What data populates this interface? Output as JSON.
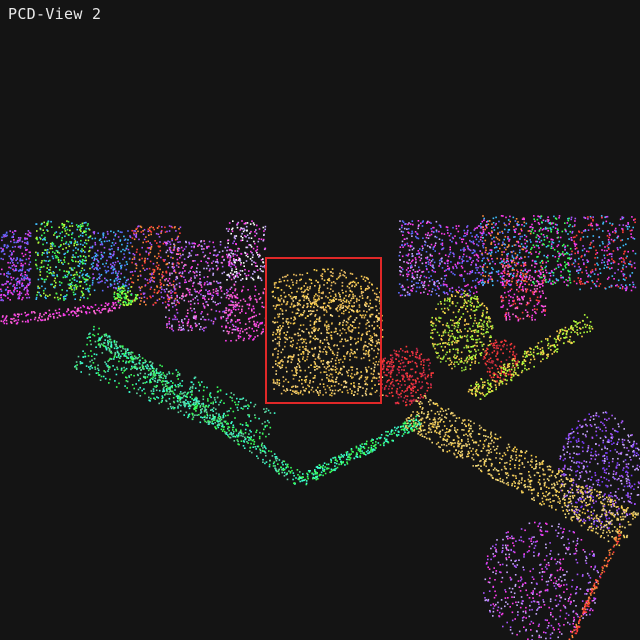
{
  "window": {
    "title": "PCD-View 2"
  },
  "viewport": {
    "background": "#141414"
  },
  "selection": {
    "color": "#e02828"
  },
  "palette": [
    "#ff3df0",
    "#a855ff",
    "#5a6bff",
    "#3fbfff",
    "#39ff5a",
    "#b4ff3a",
    "#ffd34d",
    "#ff8a3a",
    "#ff3a3a",
    "#3affd0",
    "#ff6ad5",
    "#c9a8ff"
  ]
}
